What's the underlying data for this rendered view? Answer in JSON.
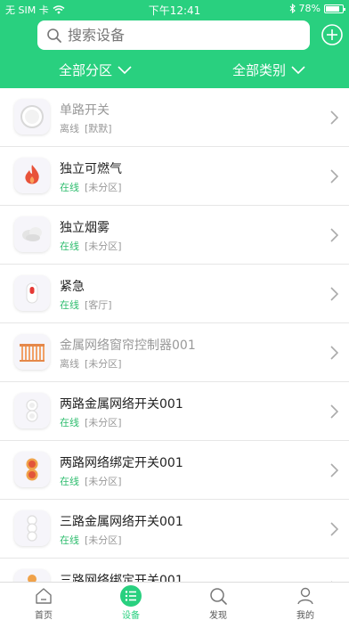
{
  "status_bar": {
    "carrier": "无 SIM 卡",
    "time": "下午12:41",
    "battery": "78%"
  },
  "search": {
    "placeholder": "搜索设备"
  },
  "filters": {
    "zone": "全部分区",
    "category": "全部类别"
  },
  "devices": [
    {
      "name": "单路开关",
      "status": "离线",
      "zone": "[默默]",
      "online": false,
      "icon": "single-switch-icon"
    },
    {
      "name": "独立可燃气",
      "status": "在线",
      "zone": "[未分区]",
      "online": true,
      "icon": "gas-sensor-icon"
    },
    {
      "name": "独立烟雾",
      "status": "在线",
      "zone": "[未分区]",
      "online": true,
      "icon": "smoke-sensor-icon"
    },
    {
      "name": "紧急",
      "status": "在线",
      "zone": "[客厅]",
      "online": true,
      "icon": "emergency-button-icon"
    },
    {
      "name": "金属网络窗帘控制器001",
      "status": "离线",
      "zone": "[未分区]",
      "online": false,
      "icon": "curtain-controller-icon"
    },
    {
      "name": "两路金属网络开关001",
      "status": "在线",
      "zone": "[未分区]",
      "online": true,
      "icon": "two-way-switch-icon"
    },
    {
      "name": "两路网络绑定开关001",
      "status": "在线",
      "zone": "[未分区]",
      "online": true,
      "icon": "two-way-bind-switch-icon"
    },
    {
      "name": "三路金属网络开关001",
      "status": "在线",
      "zone": "[未分区]",
      "online": true,
      "icon": "three-way-switch-icon"
    },
    {
      "name": "三路网络绑定开关001",
      "status": "",
      "zone": "",
      "online": true,
      "icon": "three-way-bind-switch-icon"
    }
  ],
  "tabs": [
    {
      "label": "首页",
      "icon": "home-icon",
      "active": false
    },
    {
      "label": "设备",
      "icon": "device-list-icon",
      "active": true
    },
    {
      "label": "发现",
      "icon": "discover-search-icon",
      "active": false
    },
    {
      "label": "我的",
      "icon": "profile-icon",
      "active": false
    }
  ],
  "colors": {
    "brand": "#29d07f",
    "online": "#2ebd6e",
    "offline": "#999999"
  }
}
